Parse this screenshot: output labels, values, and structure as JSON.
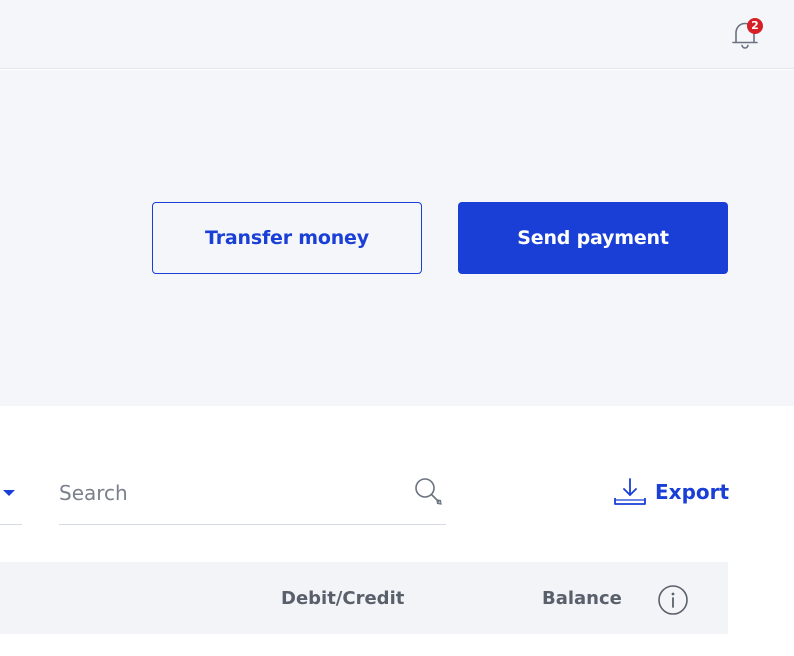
{
  "notifications": {
    "badge_count": "2",
    "icon": "bell-icon"
  },
  "actions": {
    "transfer_label": "Transfer money",
    "send_label": "Send payment"
  },
  "search": {
    "placeholder": "Search",
    "value": ""
  },
  "export": {
    "label": "Export",
    "icon": "download-icon"
  },
  "table": {
    "columns": [
      "Debit/Credit",
      "Balance"
    ],
    "info_icon": "info-icon"
  },
  "colors": {
    "accent": "#1a3fd6",
    "badge": "#d61f26",
    "background": "#f4f6fa"
  }
}
